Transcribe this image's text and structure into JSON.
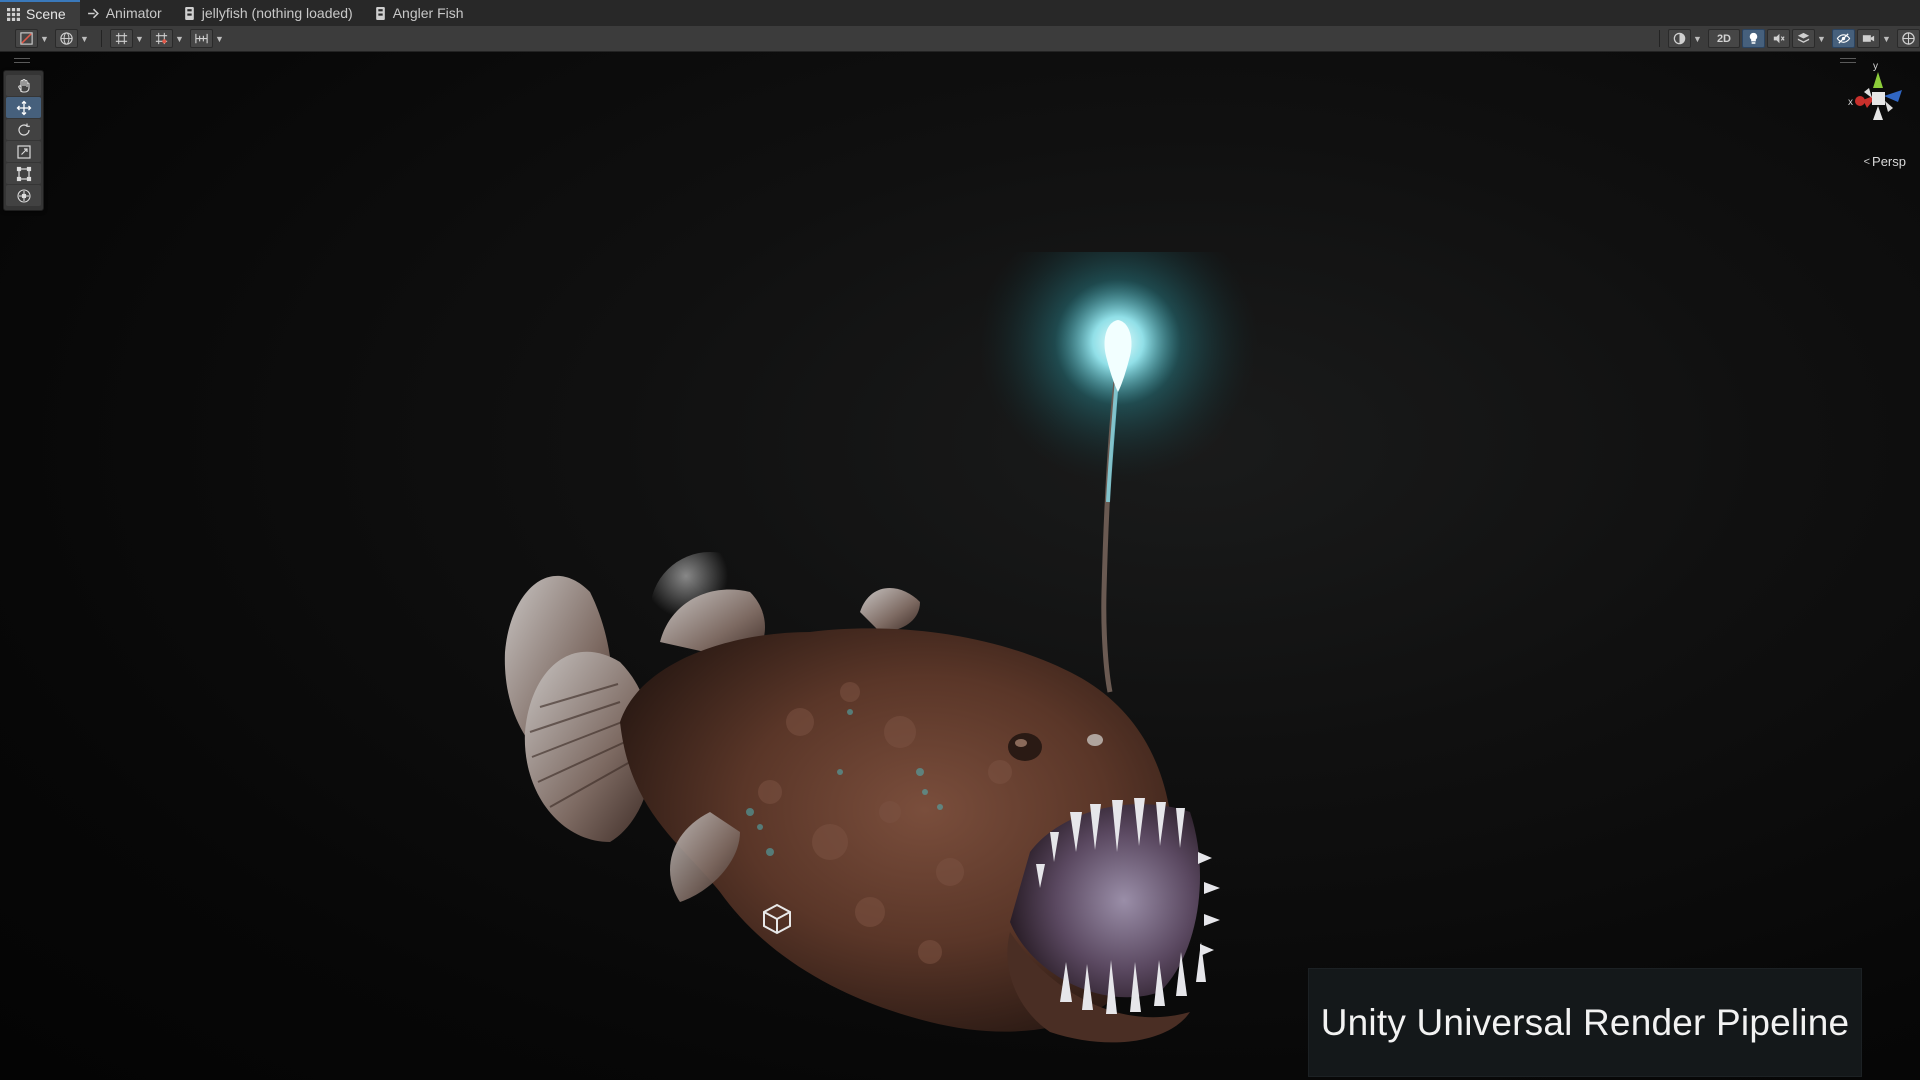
{
  "tabs": [
    {
      "label": "Scene",
      "icon": "grid-icon",
      "active": true
    },
    {
      "label": "Animator",
      "icon": "animator-icon",
      "active": false
    },
    {
      "label": "jellyfish (nothing loaded)",
      "icon": "timeline-icon",
      "active": false
    },
    {
      "label": "Angler Fish",
      "icon": "timeline-icon",
      "active": false
    }
  ],
  "toolbar": {
    "twod_label": "2D"
  },
  "gizmo": {
    "x_label": "x",
    "y_label": "y",
    "projection_label": "Persp"
  },
  "overlay": {
    "caption": "Unity Universal Render Pipeline"
  },
  "colors": {
    "accent": "#46607c",
    "lure_glow": "#7ff3ff",
    "fish_body": "#5a3a2e",
    "viewport_bg": "#0a0a0a"
  }
}
